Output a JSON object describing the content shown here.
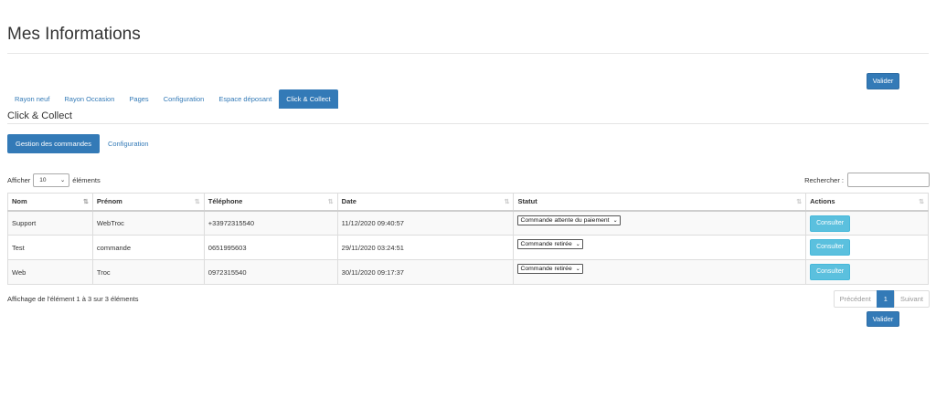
{
  "page": {
    "title": "Mes Informations"
  },
  "top_action": {
    "valider_label": "Valider"
  },
  "tabs": [
    {
      "label": "Rayon neuf",
      "active": false
    },
    {
      "label": "Rayon Occasion",
      "active": false
    },
    {
      "label": "Pages",
      "active": false
    },
    {
      "label": "Configuration",
      "active": false
    },
    {
      "label": "Espace déposant",
      "active": false
    },
    {
      "label": "Click & Collect",
      "active": true
    }
  ],
  "section": {
    "title": "Click & Collect"
  },
  "subtabs": [
    {
      "label": "Gestion des commandes",
      "active": true
    },
    {
      "label": "Configuration",
      "active": false
    }
  ],
  "table_controls": {
    "show_label": "Afficher",
    "length_value": "10",
    "elements_label": "éléments",
    "search_label": "Rechercher :",
    "search_value": ""
  },
  "table": {
    "columns": [
      "Nom",
      "Prénom",
      "Téléphone",
      "Date",
      "Statut",
      "Actions"
    ],
    "rows": [
      {
        "nom": "Support",
        "prenom": "WebTroc",
        "telephone": "+33972315540",
        "date": "11/12/2020 09:40:57",
        "statut": "Commande attente du paiement",
        "action": "Consulter"
      },
      {
        "nom": "Test",
        "prenom": "commande",
        "telephone": "0651995603",
        "date": "29/11/2020 03:24:51",
        "statut": "Commande retirée",
        "action": "Consulter"
      },
      {
        "nom": "Web",
        "prenom": "Troc",
        "telephone": "0972315540",
        "date": "30/11/2020 09:17:37",
        "statut": "Commande retirée",
        "action": "Consulter"
      }
    ]
  },
  "footer": {
    "info": "Affichage de l'élément 1 à 3 sur 3 éléments",
    "pagination": {
      "previous": "Précédent",
      "current": "1",
      "next": "Suivant"
    },
    "valider_label": "Valider"
  },
  "colors": {
    "primary": "#337ab7",
    "info": "#5bc0de"
  }
}
